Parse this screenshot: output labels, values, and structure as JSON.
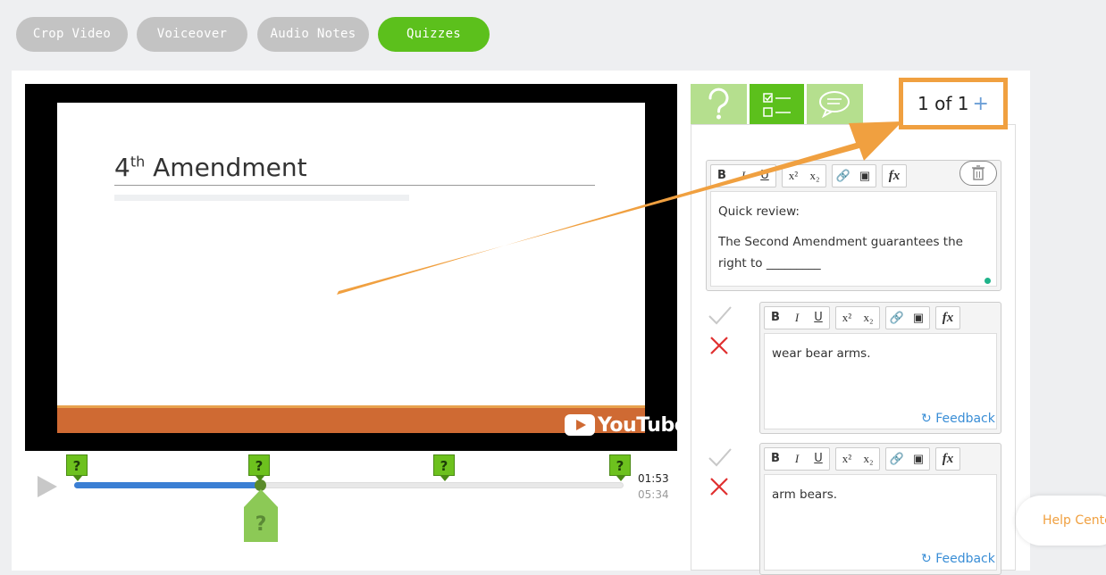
{
  "tabs": [
    {
      "label": "Crop Video",
      "active": false
    },
    {
      "label": "Voiceover",
      "active": false
    },
    {
      "label": "Audio Notes",
      "active": false
    },
    {
      "label": "Quizzes",
      "active": true
    }
  ],
  "video": {
    "slide_title_main": "4",
    "slide_title_sup": "th",
    "slide_title_rest": " Amendment",
    "youtube_label": "YouTube",
    "time_current": "01:53",
    "time_total": "05:34",
    "progress_fraction": 0.338,
    "marker_label": "?"
  },
  "quiz": {
    "counter_text": "1 of 1",
    "counter_plus": "+",
    "question_line1": "Quick review:",
    "question_line2": "The Second Amendment guarantees the right to _________",
    "answers": [
      {
        "text": "wear bear arms.",
        "feedback": "Feedback"
      },
      {
        "text": "arm bears.",
        "feedback": "Feedback"
      }
    ],
    "toolbar": {
      "bold": "B",
      "italic": "I",
      "underline": "U",
      "sup": "x²",
      "sub": "x₂",
      "fx": "fx"
    }
  },
  "help": {
    "label": "Help Center"
  },
  "colors": {
    "accent_green": "#5cc01c",
    "light_green": "#b5df8e",
    "orange": "#f0a040",
    "link_blue": "#3a8ed6",
    "red": "#e03030"
  }
}
